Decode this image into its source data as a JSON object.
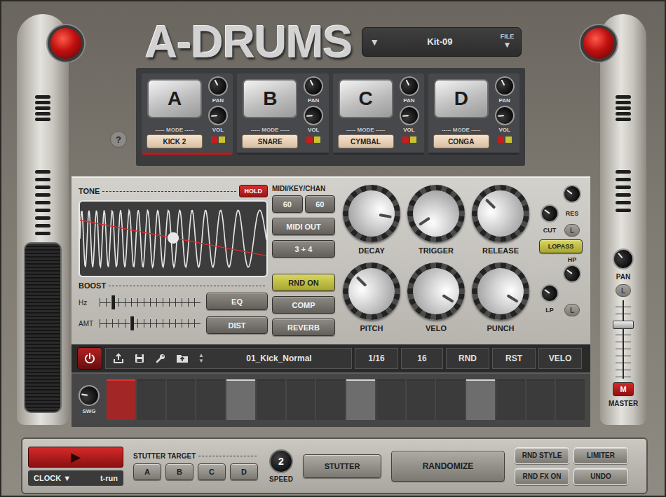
{
  "header": {
    "logo": "A-DRUMS",
    "kit": "Kit-09",
    "kit_prev": "▼",
    "file": "FILE",
    "file_arrow": "▼"
  },
  "help": "?",
  "pads": [
    {
      "letter": "A",
      "mode_label": "----- MODE -----",
      "mode": "KICK 2",
      "pan_label": "PAN",
      "vol_label": "VOL",
      "pan": 0.4,
      "vol": 0.15,
      "selected": true
    },
    {
      "letter": "B",
      "mode_label": "----- MODE -----",
      "mode": "SNARE",
      "pan_label": "PAN",
      "vol_label": "VOL",
      "pan": 0.4,
      "vol": 0.15,
      "selected": false
    },
    {
      "letter": "C",
      "mode_label": "----- MODE -----",
      "mode": "CYMBAL",
      "pan_label": "PAN",
      "vol_label": "VOL",
      "pan": 0.4,
      "vol": 0.15,
      "selected": false
    },
    {
      "letter": "D",
      "mode_label": "----- MODE -----",
      "mode": "CONGA",
      "pan_label": "PAN",
      "vol_label": "VOL",
      "pan": 0.4,
      "vol": 0.15,
      "selected": false
    }
  ],
  "tone": {
    "label": "TONE",
    "hold": "HOLD",
    "hold_on": true,
    "sweep_start": 0.25,
    "sweep_end": 0.73,
    "boost": "BOOST",
    "sliders": [
      {
        "label": "Hz",
        "level": 0.13
      },
      {
        "label": "AMT",
        "level": 0.32
      }
    ]
  },
  "effects": [
    {
      "label": "EQ",
      "on": false
    },
    {
      "label": "DIST",
      "on": false
    }
  ],
  "midi": {
    "label": "MIDI/KEY/CHAN",
    "values": [
      "60",
      "60"
    ]
  },
  "midi_buttons": [
    {
      "label": "MIDI OUT",
      "on": false
    },
    {
      "label": "3 + 4",
      "on": false
    }
  ],
  "fx_buttons": [
    {
      "label": "RND ON",
      "on": true
    },
    {
      "label": "COMP",
      "on": false
    },
    {
      "label": "REVERB",
      "on": false
    }
  ],
  "knobs": [
    {
      "label": "DECAY",
      "level": 0.87
    },
    {
      "label": "TRIGGER",
      "level": 0.04
    },
    {
      "label": "RELEASE",
      "level": 0.33
    },
    {
      "label": "PITCH",
      "level": 0.33
    },
    {
      "label": "VELO",
      "level": 0.95
    },
    {
      "label": "PUNCH",
      "level": 0.95
    }
  ],
  "filter": {
    "res": {
      "label": "RES",
      "level": 0.3
    },
    "cut": {
      "label": "CUT",
      "level": 0.3
    },
    "hp": {
      "label": "HP",
      "level": 0.3
    },
    "lp": {
      "label": "LP",
      "level": 0.3
    },
    "links": [
      "L",
      "L"
    ],
    "mode": "LOPASS",
    "mode_on": true
  },
  "sequencer": {
    "power_on": true,
    "pattern": "01_Kick_Normal",
    "up": "▲",
    "down": "▼",
    "resolution": "1/16",
    "length": "16",
    "buttons": [
      "RND",
      "RST",
      "VELO"
    ],
    "swing_label": "SWG",
    "swing": 0.2,
    "steps": [
      {
        "on": true,
        "current": true
      },
      {
        "on": false,
        "current": false
      },
      {
        "on": false,
        "current": false
      },
      {
        "on": false,
        "current": false
      },
      {
        "on": true,
        "current": false
      },
      {
        "on": false,
        "current": false
      },
      {
        "on": false,
        "current": false
      },
      {
        "on": false,
        "current": false
      },
      {
        "on": true,
        "current": false
      },
      {
        "on": false,
        "current": false
      },
      {
        "on": false,
        "current": false
      },
      {
        "on": false,
        "current": false
      },
      {
        "on": true,
        "current": false
      },
      {
        "on": false,
        "current": false
      },
      {
        "on": false,
        "current": false
      },
      {
        "on": false,
        "current": false
      }
    ]
  },
  "master": {
    "pan_label": "PAN",
    "pan": 0.35,
    "link": "L",
    "fader": 0.71,
    "mute": "M",
    "mute_on": true,
    "label": "MASTER"
  },
  "transport": {
    "play": "▶",
    "clock": "CLOCK",
    "clock_arrow": "▼",
    "mode": "t-run"
  },
  "stutter": {
    "label": "STUTTER TARGET",
    "targets": [
      {
        "label": "A",
        "selected": false
      },
      {
        "label": "B",
        "selected": false
      },
      {
        "label": "C",
        "selected": false
      },
      {
        "label": "D",
        "selected": false
      }
    ],
    "speed": "2",
    "speed_label": "SPEED",
    "button": "STUTTER"
  },
  "randomize": "RANDOMIZE",
  "options": [
    "RND STYLE",
    "LIMITER",
    "RND FX ON",
    "UNDO"
  ]
}
